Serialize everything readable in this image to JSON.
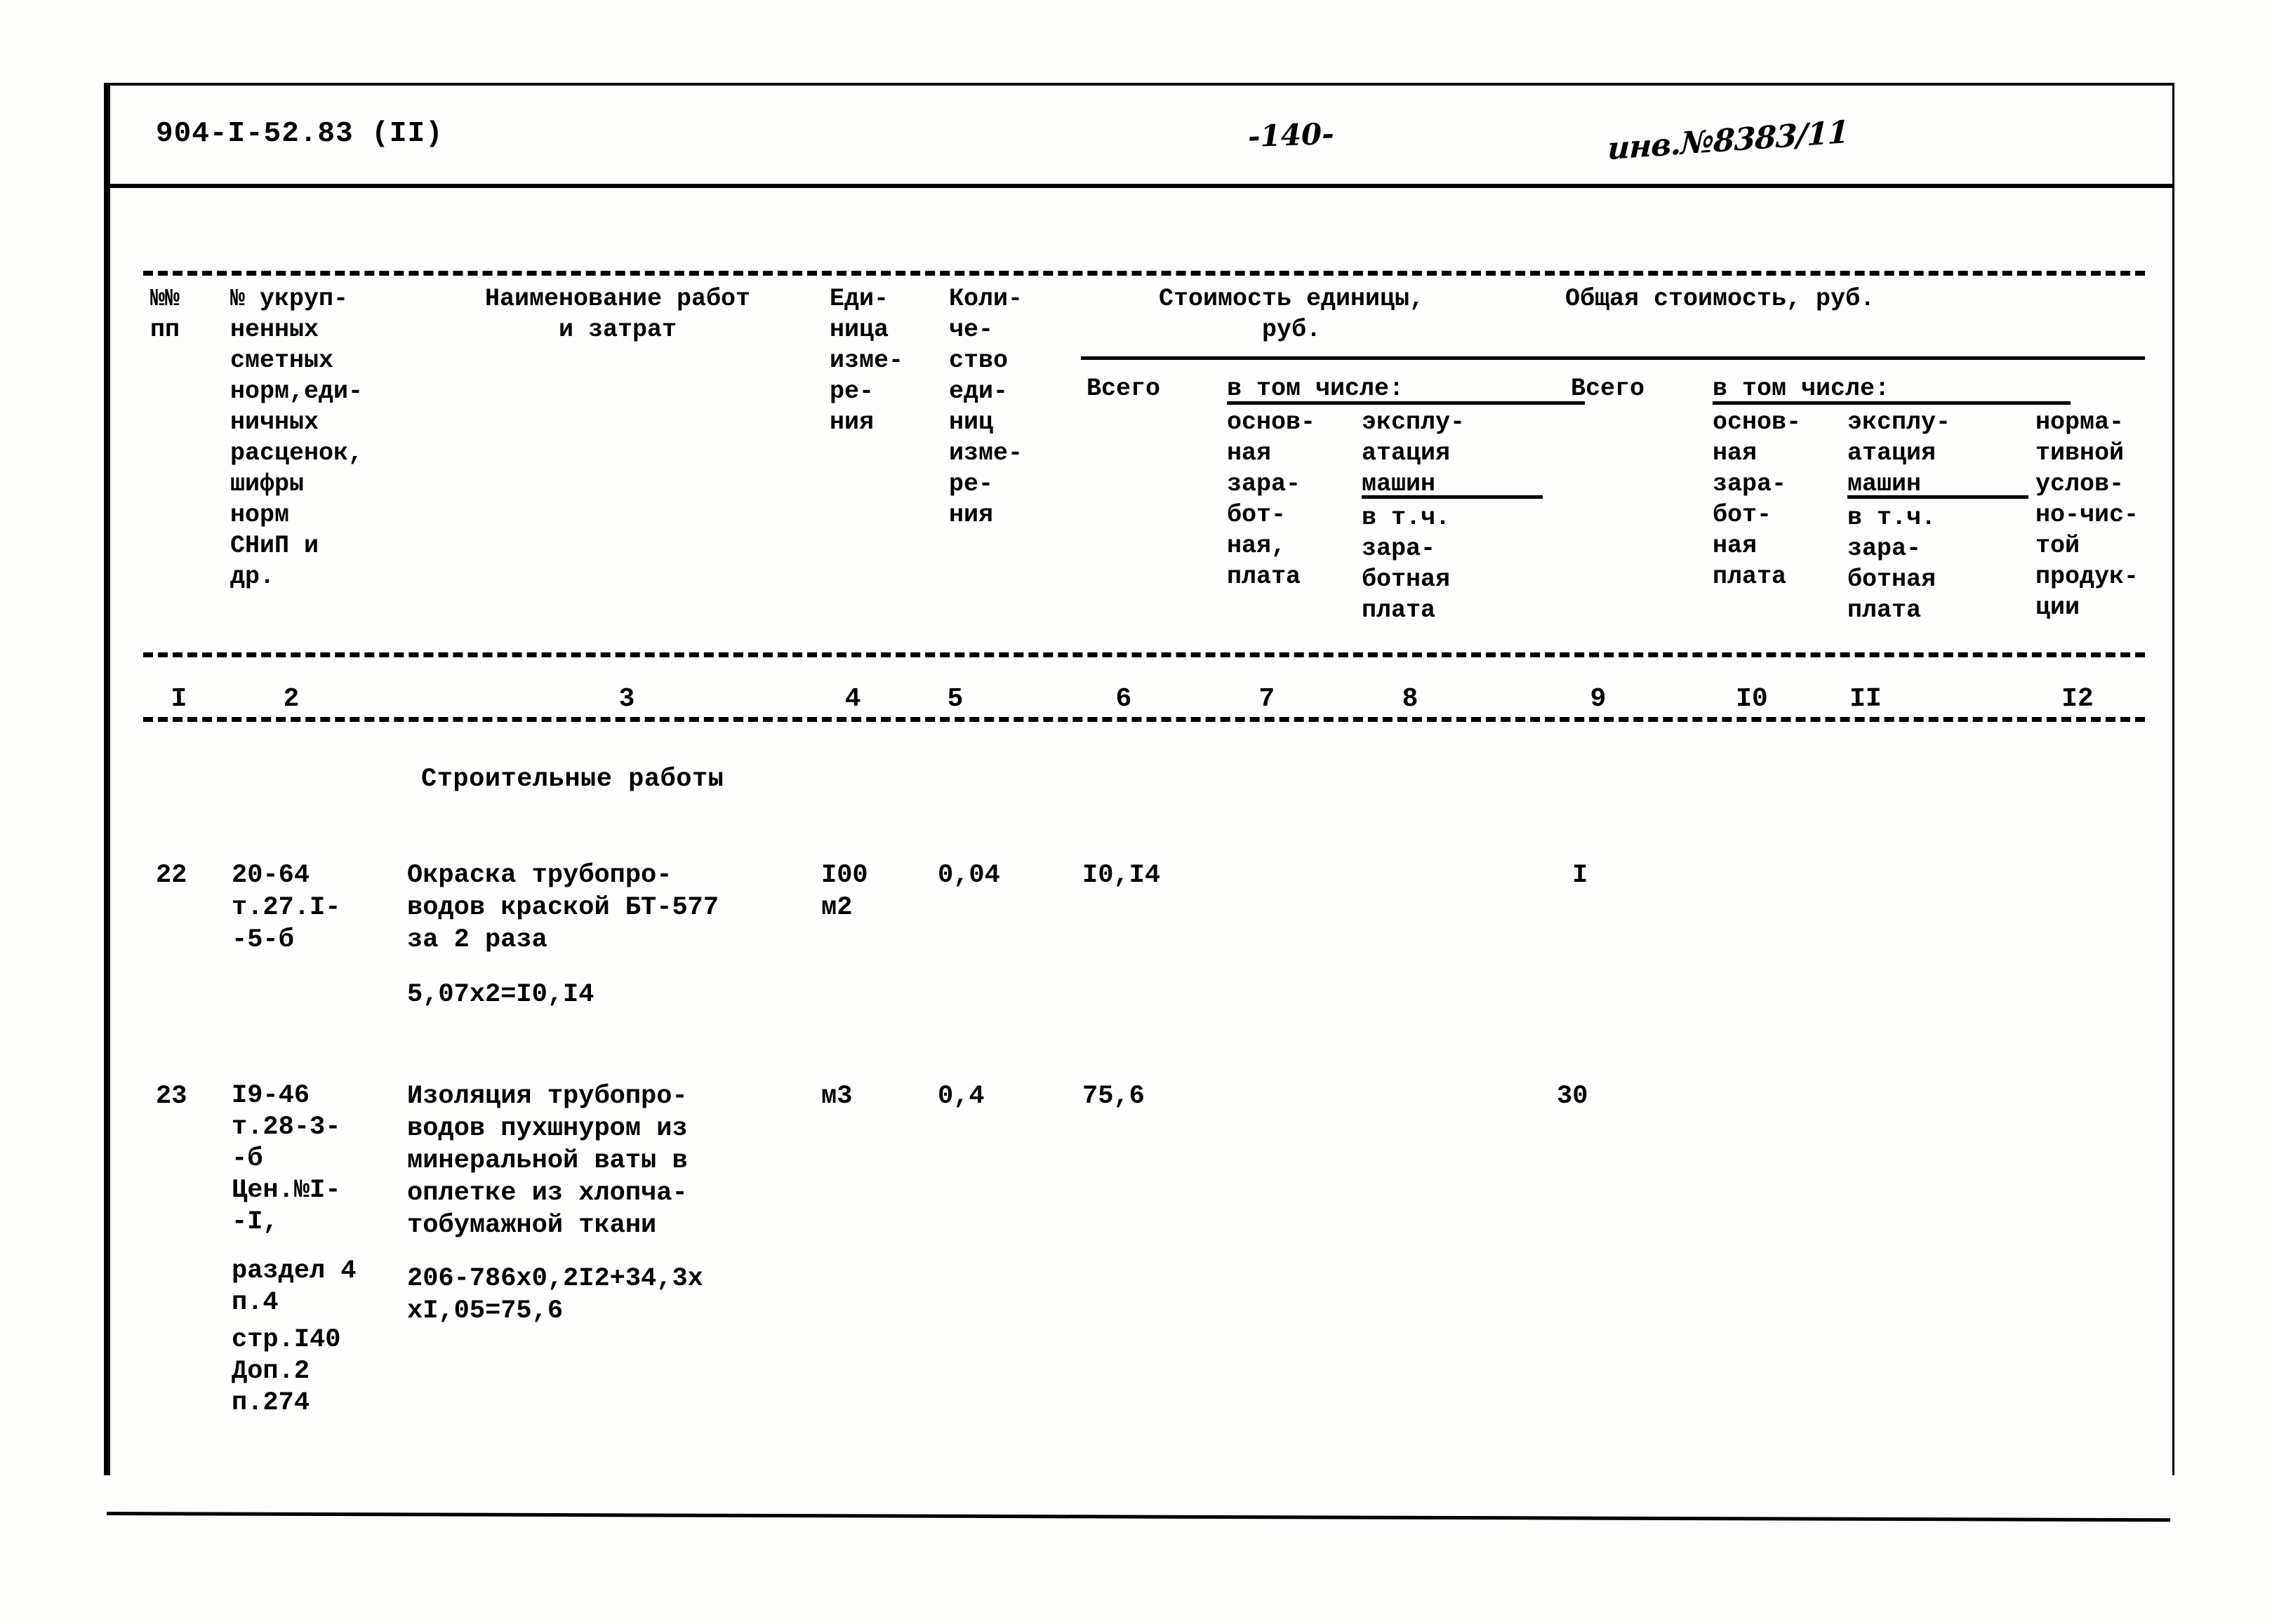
{
  "header": {
    "doc_code": "904-I-52.83 (II)",
    "page_number": "-140-",
    "inventory_number": "инв.№8383/11"
  },
  "table": {
    "columns": [
      {
        "num": "I",
        "title": "№№\nпп"
      },
      {
        "num": "2",
        "title": "№ укруп-\nненных\nсметных\nнорм,еди-\nничных\nрасценок,\nшифры\nнорм\nСНиП и\nдр."
      },
      {
        "num": "3",
        "title": "Наименование работ\nи затрат"
      },
      {
        "num": "4",
        "title": "Еди-\nница\nизме-\nре-\nния"
      },
      {
        "num": "5",
        "title": "Коли-\nче-\nство\nеди-\nниц\nизме-\nре-\nния"
      },
      {
        "num": "6",
        "title": "Всего"
      },
      {
        "num": "7",
        "title": "основ-\nная\nзара-\nбот-\nная,\nплата"
      },
      {
        "num": "8",
        "title": "эксплу-\nатация\nмашин"
      },
      {
        "num": "9",
        "title": "Всего"
      },
      {
        "num": "I0",
        "title": "основ-\nная\nзара-\nбот-\nная\nплата"
      },
      {
        "num": "II",
        "title": "эксплу-\nатация\nмашин"
      },
      {
        "num": "I2",
        "title": "норма-\nтивной\nуслов-\nно-чис-\nтой\nпродук-\nции"
      }
    ],
    "group_headers": {
      "unit_cost": "Стоимость единицы,\nруб.",
      "total_cost": "Общая стоимость, руб.",
      "included_1": "в том числе:",
      "included_2": "в том числе:"
    },
    "sub_labels": {
      "in_that_number_1": "в т.ч.\nзара-\nботная\nплата",
      "in_that_number_2": "в т.ч.\nзара-\nботная\nплата"
    },
    "section_title": "Строительные работы",
    "rows": [
      {
        "no": "22",
        "code": "20-64\nт.27.I-\n-5-б",
        "name": "Окраска трубопро-\nводов краской БТ-577\nза 2 раза",
        "calc": "5,07x2=I0,I4",
        "unit": "I00\nм2",
        "qty": "0,04",
        "unit_total": "I0,I4",
        "unit_wage": "",
        "unit_machines": "",
        "grand_total": "I",
        "grand_wage": "",
        "grand_machines": "",
        "nchp": ""
      },
      {
        "no": "23",
        "code": "I9-46\nт.28-3-\n-б\nЦен.№I-\n-I,",
        "code2": "раздел 4\nп.4",
        "code3": "стр.I40\nДоп.2\nп.274",
        "name": "Изоляция трубопро-\nводов пухшнуром из\nминеральной ваты в\nоплетке из хлопча-\nтобумажной ткани",
        "calc": "206-786x0,2I2+34,3x\nxI,05=75,6",
        "unit": "м3",
        "qty": "0,4",
        "unit_total": "75,6",
        "unit_wage": "",
        "unit_machines": "",
        "grand_total": "30",
        "grand_wage": "",
        "grand_machines": "",
        "nchp": ""
      }
    ]
  }
}
